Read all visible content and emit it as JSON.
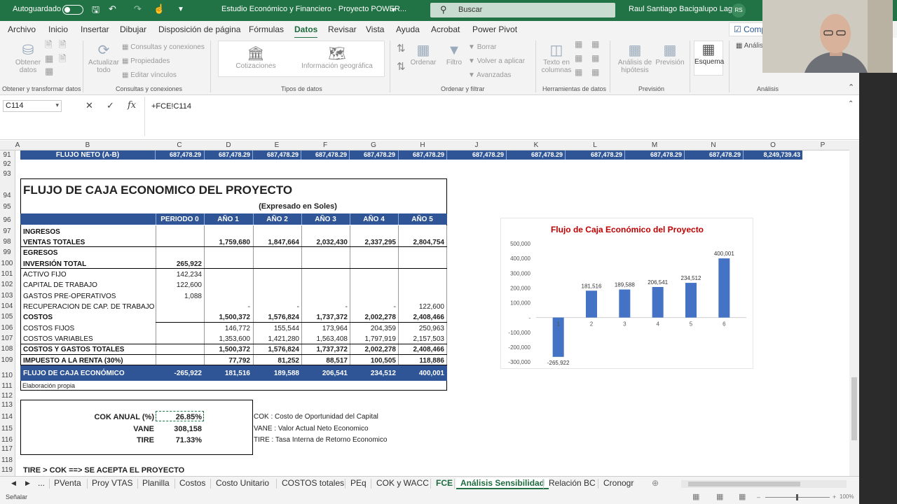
{
  "titlebar": {
    "autosave": "Autoguardado",
    "doc_title": "Estudio Económico y Financiero - Proyecto POWER...",
    "search": "Buscar",
    "user": "Raul Santiago Bacigalupo Lago",
    "initials": "RS"
  },
  "menu": [
    "Archivo",
    "Inicio",
    "Insertar",
    "Dibujar",
    "Disposición de página",
    "Fórmulas",
    "Datos",
    "Revisar",
    "Vista",
    "Ayuda",
    "Acrobat",
    "Power Pivot"
  ],
  "comp_button": "Comp",
  "ribbon": {
    "obtener": "Obtener",
    "datos": "datos",
    "actualizar": "Actualizar",
    "todo": "todo",
    "consultas": "Consultas y conexiones",
    "propiedades": "Propiedades",
    "editar": "Editar vínculos",
    "cotizaciones": "Cotizaciones",
    "geo": "Información geográfica",
    "ordenar": "Ordenar",
    "filtro": "Filtro",
    "borrar": "Borrar",
    "volver": "Volver a aplicar",
    "avanzadas": "Avanzadas",
    "texto": "Texto en",
    "columnas": "columnas",
    "analisis_h": "Análisis de",
    "hipotesis": "hipótesis",
    "prevision": "Previsión",
    "esquema": "Esquema",
    "analisis": "Anális",
    "groups": {
      "g1": "Obtener y transformar datos",
      "g2": "Consultas y conexiones",
      "g3": "Tipos de datos",
      "g4": "Ordenar y filtrar",
      "g5": "Herramientas de datos",
      "g6": "Previsión",
      "g7": "Análisis"
    }
  },
  "formula_bar": {
    "cell": "C114",
    "formula": "+FCE!C114"
  },
  "columns": [
    "A",
    "B",
    "C",
    "D",
    "E",
    "F",
    "G",
    "H",
    "J",
    "K",
    "L",
    "M",
    "N",
    "O",
    "P"
  ],
  "rows": [
    "91",
    "92",
    "93",
    "94",
    "95",
    "96",
    "97",
    "98",
    "99",
    "100",
    "101",
    "102",
    "103",
    "104",
    "105",
    "106",
    "107",
    "108",
    "109",
    "110",
    "111",
    "112",
    "113",
    "114",
    "115",
    "116",
    "117",
    "118",
    "119"
  ],
  "flujo_neto": {
    "label": "FLUJO NETO (A-B)",
    "values": [
      "687,478.29",
      "687,478.29",
      "687,478.29",
      "687,478.29",
      "687,478.29",
      "687,478.29",
      "687,478.29",
      "687,478.29",
      "687,478.29",
      "687,478.29",
      "687,478.29",
      "8,249,739.43"
    ]
  },
  "table": {
    "title": "FLUJO DE CAJA ECONOMICO DEL PROYECTO",
    "subtitle": "(Expresado en Soles)",
    "headers": [
      "PERIODO 0",
      "AÑO 1",
      "AÑO 2",
      "AÑO 3",
      "AÑO 4",
      "AÑO 5"
    ],
    "rows": [
      {
        "label": "INGRESOS",
        "bold": true,
        "v": [
          "",
          "",
          "",
          "",
          "",
          ""
        ]
      },
      {
        "label": "VENTAS TOTALES",
        "bold": true,
        "v": [
          "",
          "1,759,680",
          "1,847,664",
          "2,032,430",
          "2,337,295",
          "2,804,754"
        ]
      },
      {
        "label": "EGRESOS",
        "bold": true,
        "v": [
          "",
          "",
          "",
          "",
          "",
          ""
        ]
      },
      {
        "label": "INVERSIÓN TOTAL",
        "bold": true,
        "v": [
          "265,922",
          "",
          "",
          "",
          "",
          ""
        ]
      },
      {
        "label": "ACTIVO FIJO",
        "bold": false,
        "v": [
          "142,234",
          "",
          "",
          "",
          "",
          ""
        ]
      },
      {
        "label": "CAPITAL DE TRABAJO",
        "bold": false,
        "v": [
          "122,600",
          "",
          "",
          "",
          "",
          ""
        ]
      },
      {
        "label": "GASTOS PRE-OPERATIVOS",
        "bold": false,
        "v": [
          "1,088",
          "",
          "",
          "",
          "",
          ""
        ]
      },
      {
        "label": "RECUPERACION DE CAP. DE TRABAJO",
        "bold": false,
        "v": [
          "",
          "-",
          "-",
          "-",
          "-",
          "122,600"
        ]
      },
      {
        "label": "COSTOS",
        "bold": true,
        "v": [
          "",
          "1,500,372",
          "1,576,824",
          "1,737,372",
          "2,002,278",
          "2,408,466"
        ]
      },
      {
        "label": "COSTOS FIJOS",
        "bold": false,
        "v": [
          "",
          "146,772",
          "155,544",
          "173,964",
          "204,359",
          "250,963"
        ]
      },
      {
        "label": "COSTOS VARIABLES",
        "bold": false,
        "v": [
          "",
          "1,353,600",
          "1,421,280",
          "1,563,408",
          "1,797,919",
          "2,157,503"
        ]
      },
      {
        "label": "COSTOS Y GASTOS TOTALES",
        "bold": true,
        "v": [
          "",
          "1,500,372",
          "1,576,824",
          "1,737,372",
          "2,002,278",
          "2,408,466"
        ]
      },
      {
        "label": "IMPUESTO A LA RENTA (30%)",
        "bold": true,
        "v": [
          "",
          "77,792",
          "81,252",
          "88,517",
          "100,505",
          "118,886"
        ]
      }
    ],
    "fce": {
      "label": "FLUJO DE CAJA ECONÓMICO",
      "v": [
        "-265,922",
        "181,516",
        "189,588",
        "206,541",
        "234,512",
        "400,001"
      ]
    },
    "source": "Elaboración propia"
  },
  "indicators": [
    {
      "label": "COK ANUAL (%)",
      "value": "26.85%"
    },
    {
      "label": "VANE",
      "value": "308,158"
    },
    {
      "label": "TIRE",
      "value": "71.33%"
    }
  ],
  "legend_notes": [
    "COK : Costo de Oportunidad del Capital",
    "VANE : Valor Actual Neto Economico",
    "TIRE : Tasa Interna de Retorno Economico"
  ],
  "conclusion": "TIRE > COK ==> SE ACEPTA EL PROYECTO",
  "chart_data": {
    "type": "bar",
    "title": "Flujo de Caja Económico del Proyecto",
    "categories": [
      "1",
      "2",
      "3",
      "4",
      "5",
      "6"
    ],
    "values": [
      -265922,
      181516,
      189588,
      206541,
      234512,
      400001
    ],
    "data_labels": [
      "-265,922",
      "181,516",
      "189,588",
      "206,541",
      "234,512",
      "400,001"
    ],
    "ylim": [
      -300000,
      500000
    ],
    "yticks": [
      "500,000",
      "400,000",
      "300,000",
      "200,000",
      "100,000",
      "-",
      "-100,000",
      "-200,000",
      "-300,000"
    ],
    "bar_color": "#4472c4",
    "title_color": "#c00000"
  },
  "sheet_tabs": [
    "PVenta",
    "Proy VTAS",
    "Planilla",
    "Costos",
    "Costo Unitario",
    "COSTOS totales",
    "PEq",
    "COK y WACC",
    "FCE",
    "Análisis Sensibilidad",
    "Relación BC",
    "Cronogr"
  ],
  "active_tab": "Análisis Sensibilidad",
  "status": "Señalar",
  "zoom": "100%"
}
